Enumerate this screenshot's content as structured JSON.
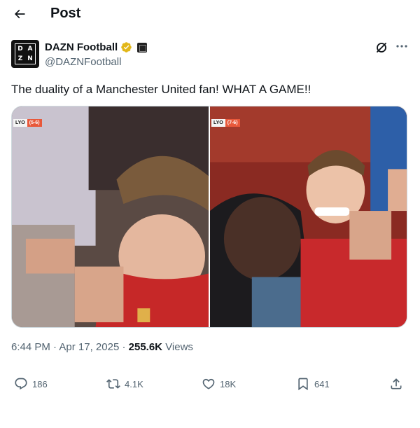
{
  "header": {
    "title": "Post"
  },
  "post": {
    "author": {
      "name": "DAZN Football",
      "handle": "@DAZNFootball",
      "avatar_letters": [
        "D",
        "A",
        "Z",
        "N"
      ]
    },
    "text": "The duality of a Manchester United fan! WHAT A GAME!!",
    "media": [
      {
        "score_team": "LYO",
        "score_value": "(5-6)"
      },
      {
        "score_team": "LYO",
        "score_value": "(7-6)"
      }
    ],
    "time": "6:44 PM",
    "separator": "·",
    "date": "Apr 17, 2025",
    "views_count": "255.6K",
    "views_label": "Views"
  },
  "actions": {
    "replies": "186",
    "reposts": "4.1K",
    "likes": "18K",
    "bookmarks": "641"
  },
  "colors": {
    "text": "#0f1419",
    "secondary": "#536471",
    "verified": "#e2b719",
    "border": "#cfd9de"
  }
}
